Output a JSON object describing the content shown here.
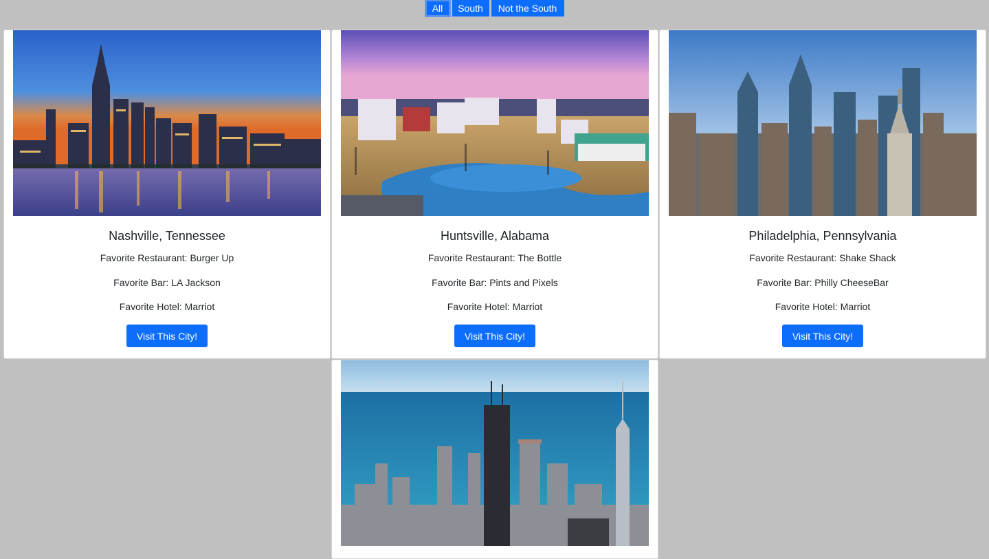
{
  "filters": [
    {
      "label": "All",
      "active": true
    },
    {
      "label": "South",
      "active": false
    },
    {
      "label": "Not the South",
      "active": false
    }
  ],
  "cards": [
    {
      "city": "Nashville, Tennessee",
      "restaurant": "Favorite Restaurant: Burger Up",
      "bar": "Favorite Bar: LA Jackson",
      "hotel": "Favorite Hotel: Marriot",
      "button": "Visit This City!"
    },
    {
      "city": "Huntsville, Alabama",
      "restaurant": "Favorite Restaurant: The Bottle",
      "bar": "Favorite Bar: Pints and Pixels",
      "hotel": "Favorite Hotel: Marriot",
      "button": "Visit This City!"
    },
    {
      "city": "Philadelphia, Pennsylvania",
      "restaurant": "Favorite Restaurant: Shake Shack",
      "bar": "Favorite Bar: Philly CheeseBar",
      "hotel": "Favorite Hotel: Marriot",
      "button": "Visit This City!"
    }
  ],
  "colors": {
    "page_bg": "#c0c0c0",
    "button_bg": "#0d6efd",
    "card_bg": "#ffffff"
  }
}
